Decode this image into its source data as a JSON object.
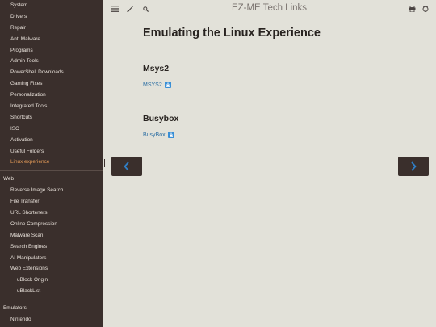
{
  "sidebar": {
    "group1": [
      {
        "label": "System"
      },
      {
        "label": "Drivers"
      },
      {
        "label": "Repair"
      },
      {
        "label": "Anti Malware"
      },
      {
        "label": "Programs"
      },
      {
        "label": "Admin Tools"
      },
      {
        "label": "PowerShell Downloads"
      },
      {
        "label": "Gaming Fixes"
      },
      {
        "label": "Personalization"
      },
      {
        "label": "Integrated Tools"
      },
      {
        "label": "Shortcuts"
      },
      {
        "label": "ISO"
      },
      {
        "label": "Activation"
      },
      {
        "label": "Useful Folders"
      },
      {
        "label": "Linux experience"
      }
    ],
    "web_heading": "Web",
    "web_items": [
      {
        "label": "Reverse Image Search"
      },
      {
        "label": "File Transfer"
      },
      {
        "label": "URL Shorteners"
      },
      {
        "label": "Online Compression"
      },
      {
        "label": "Malware Scan"
      },
      {
        "label": "Search Engines"
      },
      {
        "label": "AI Manipulators"
      },
      {
        "label": "Web Extensions"
      }
    ],
    "web_ext_children": [
      {
        "label": "uBlock Origin"
      },
      {
        "label": "uBlackList"
      }
    ],
    "emulators_heading": "Emulators",
    "emulator_items": [
      {
        "label": "Nintendo"
      }
    ],
    "active_color": "#e39a57"
  },
  "header": {
    "title": "EZ-ME Tech Links",
    "icons": [
      "menu-icon",
      "brush-icon",
      "search-icon",
      "print-icon",
      "github-icon"
    ]
  },
  "main": {
    "page_title": "Emulating the Linux Experience",
    "sections": [
      {
        "heading": "Msys2",
        "link": "MSYS2"
      },
      {
        "heading": "Busybox",
        "link": "BusyBox"
      }
    ]
  },
  "nav": {
    "prev_icon": "chevron-left-icon",
    "next_icon": "chevron-right-icon",
    "accent": "#2f7fc7"
  }
}
